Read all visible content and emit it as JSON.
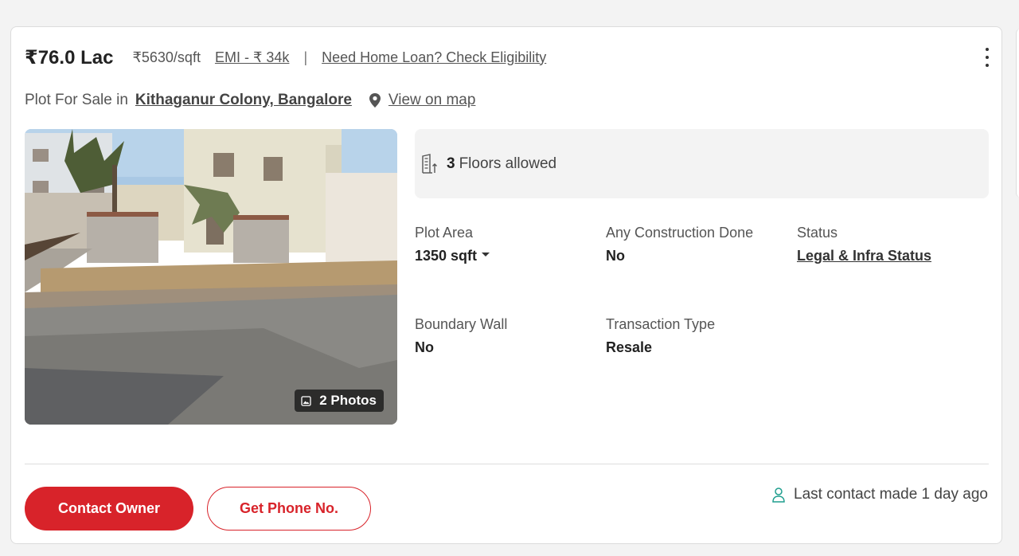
{
  "listing": {
    "price": "₹76.0 Lac",
    "rate": "₹5630/sqft",
    "emi": "EMI - ₹ 34k",
    "separator": "|",
    "loan_link": "Need Home Loan? Check Eligibility",
    "location_prefix": "Plot For Sale in",
    "location": "Kithaganur Colony, Bangalore",
    "map_link": "View on map",
    "photos_label": "2 Photos",
    "floors_count": "3",
    "floors_label": "Floors allowed"
  },
  "attributes": {
    "plot_area_label": "Plot Area",
    "plot_area_value": "1350 sqft",
    "construction_label": "Any Construction Done",
    "construction_value": "No",
    "status_label": "Status",
    "status_link": "Legal & Infra Status",
    "boundary_label": "Boundary Wall",
    "boundary_value": "No",
    "transaction_label": "Transaction Type",
    "transaction_value": "Resale"
  },
  "actions": {
    "contact_owner": "Contact Owner",
    "get_phone": "Get Phone No.",
    "last_contact": "Last contact made 1 day ago"
  },
  "icons": {
    "menu": "kebab-menu-icon",
    "location": "location-pin-icon",
    "photos": "gallery-icon",
    "floors": "building-floors-icon",
    "dropdown": "caret-down-icon",
    "person": "person-icon"
  },
  "colors": {
    "accent": "#d8232a",
    "person_icon": "#1f9e8e"
  }
}
